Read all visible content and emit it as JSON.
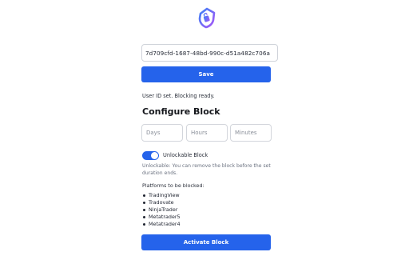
{
  "brand": {
    "logo_icon": "shield-lock-logo-icon",
    "colors": {
      "gradient_start": "#3b82f6",
      "gradient_end": "#a855f7"
    }
  },
  "user_id": {
    "value": "7d709cfd-1687-48bd-990c-d51a482c706a",
    "placeholder": ""
  },
  "save_button": {
    "label": "Save"
  },
  "status_text": "User ID set. Blocking ready.",
  "configure": {
    "title": "Configure Block",
    "days_placeholder": "Days",
    "hours_placeholder": "Hours",
    "minutes_placeholder": "Minutes"
  },
  "unlockable": {
    "label": "Unlockable Block",
    "enabled": true,
    "note": "Unlockable: You can remove the block before the set duration ends."
  },
  "platforms": {
    "title": "Platforms to be blocked:",
    "items": [
      "TradingView",
      "Tradovate",
      "NinjaTrader",
      "Metatrader5",
      "Metatrader4"
    ]
  },
  "activate_button": {
    "label": "Activate Block"
  },
  "colors": {
    "accent": "#2563eb",
    "muted_text": "#6b7280"
  }
}
